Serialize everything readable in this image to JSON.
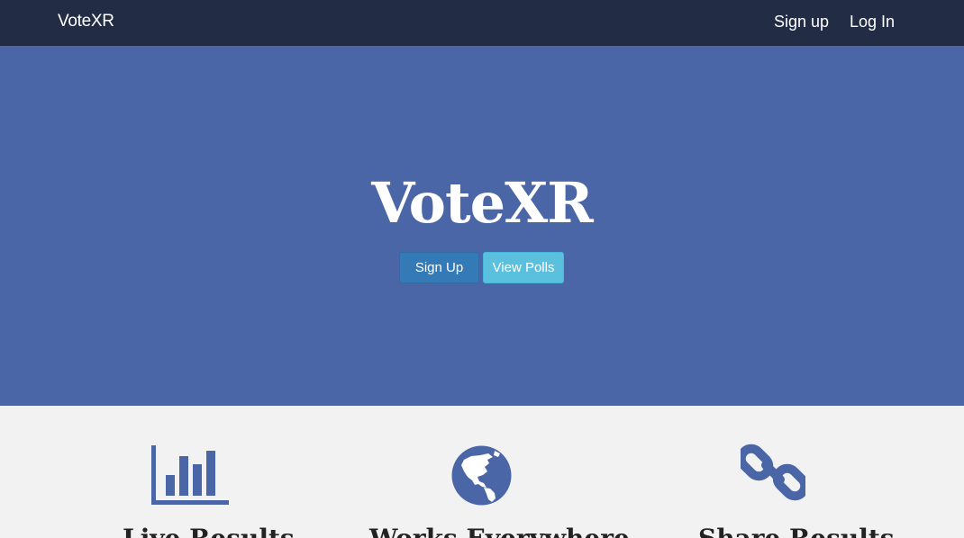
{
  "navbar": {
    "brand": "VoteXR",
    "links": {
      "signup": "Sign up",
      "login": "Log In"
    }
  },
  "hero": {
    "title": "VoteXR",
    "buttons": {
      "signup": "Sign Up",
      "view_polls": "View Polls"
    }
  },
  "features": {
    "items": [
      {
        "icon": "bar-chart-icon",
        "title": "Live Results"
      },
      {
        "icon": "globe-icon",
        "title": "Works Everywhere"
      },
      {
        "icon": "link-icon",
        "title": "Share Results"
      }
    ]
  },
  "colors": {
    "navbar_bg": "#222c45",
    "hero_bg": "#4a66a6",
    "primary_button": "#337ab7",
    "info_button": "#5bc0de",
    "icon_color": "#4a66a6",
    "features_bg": "#f2f2f2"
  }
}
